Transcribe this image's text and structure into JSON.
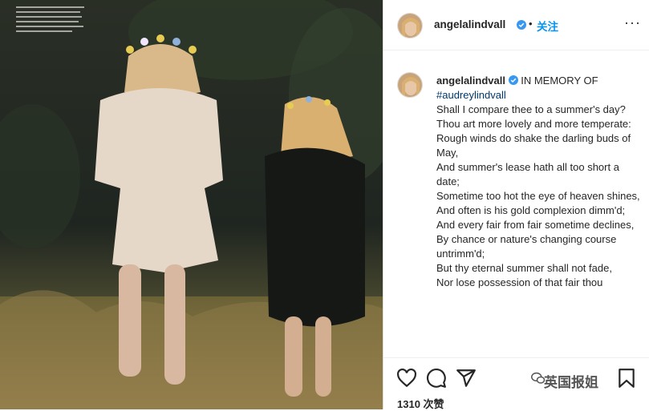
{
  "post": {
    "username": "angelalindvall",
    "follow_label": "关注",
    "dot": "•",
    "more": "···",
    "views": "1310 次赞"
  },
  "caption": {
    "username": "angelalindvall",
    "lead": "IN MEMORY OF",
    "hashtag": "#audreylindvall",
    "lines": [
      "Shall I compare thee to a summer's day?",
      "Thou art more lovely and more temperate:",
      "Rough winds do shake the darling buds of May,",
      "And summer's lease hath all too short a date;",
      "Sometime too hot the eye of heaven shines,",
      "And often is his gold complexion dimm'd;",
      "And every fair from fair sometime declines,",
      "By chance or nature's changing course untrimm'd;",
      "But thy eternal summer shall not fade,",
      "Nor lose possession of that fair thou"
    ]
  },
  "watermark": "英国报姐",
  "colors": {
    "follow": "#0095f6",
    "verified": "#3897f0"
  },
  "icons": [
    "heart-icon",
    "comment-icon",
    "share-icon",
    "bookmark-icon",
    "more-icon",
    "verified-icon"
  ]
}
